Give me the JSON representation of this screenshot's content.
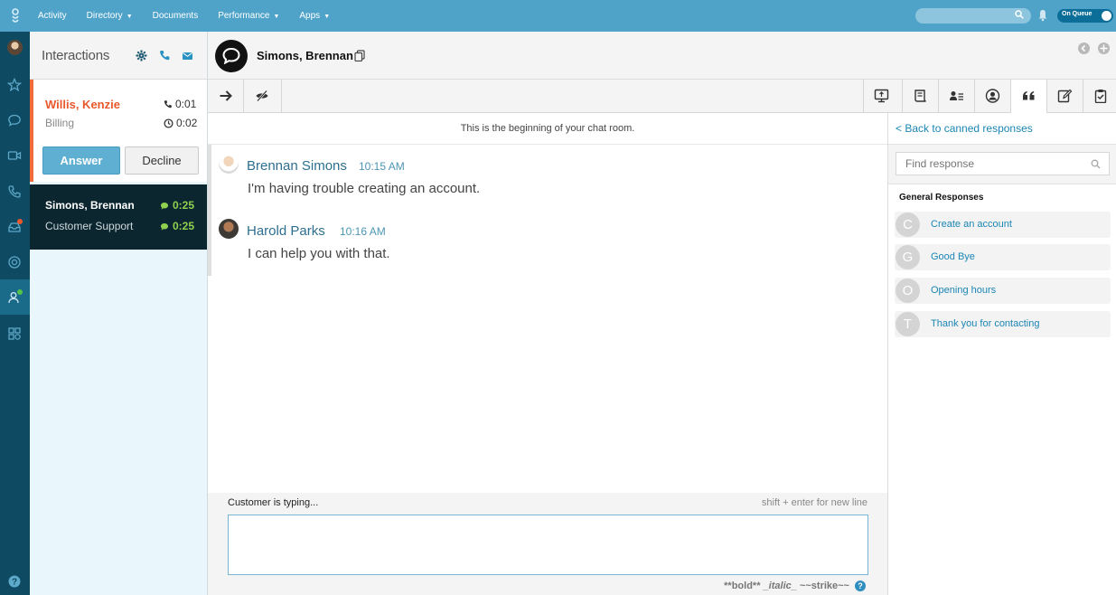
{
  "topnav": {
    "items": [
      {
        "label": "Activity",
        "dropdown": false
      },
      {
        "label": "Directory",
        "dropdown": true
      },
      {
        "label": "Documents",
        "dropdown": false
      },
      {
        "label": "Performance",
        "dropdown": true
      },
      {
        "label": "Apps",
        "dropdown": true
      }
    ],
    "caret": "▼",
    "search_placeholder": "",
    "queue_status": "On Queue"
  },
  "rail": {
    "icons": [
      "avatar",
      "star-icon",
      "chat-icon",
      "video-icon",
      "phone-icon",
      "inbox-icon",
      "lifebuoy-icon",
      "person-icon",
      "apps-icon",
      "help-icon"
    ]
  },
  "interactions": {
    "title": "Interactions",
    "alerting": {
      "name": "Willis, Kenzie",
      "queue": "Billing",
      "call_time": "0:01",
      "wait_time": "0:02",
      "answer_label": "Answer",
      "decline_label": "Decline"
    },
    "active": {
      "name": "Simons, Brennan",
      "queue": "Customer Support",
      "time1": "0:25",
      "time2": "0:25"
    }
  },
  "conversation": {
    "contact_name": "Simons, Brennan",
    "beginning_text": "This is the beginning of your chat room.",
    "messages": [
      {
        "sender": "Brennan Simons",
        "time": "10:15 AM",
        "text": "I'm having trouble creating an account."
      },
      {
        "sender": "Harold Parks",
        "time": "10:16 AM",
        "text": "I can help you with that."
      }
    ],
    "typing_status": "Customer is typing...",
    "newline_hint": "shift + enter for new line",
    "composer_value": "",
    "format_bold": "**bold**",
    "format_italic": "_italic_",
    "format_strike": "~~strike~~",
    "help_glyph": "?"
  },
  "canned": {
    "back_label": "< Back to canned responses",
    "search_placeholder": "Find response",
    "group_title": "General Responses",
    "responses": [
      {
        "letter": "C",
        "label": "Create an account"
      },
      {
        "letter": "G",
        "label": "Good Bye"
      },
      {
        "letter": "O",
        "label": "Opening hours"
      },
      {
        "letter": "T",
        "label": "Thank you for contacting"
      }
    ]
  },
  "colors": {
    "topbar": "#4fa3c9",
    "rail": "#0f4a63",
    "alert_accent": "#f26b3a",
    "answer_button": "#5fafd3",
    "active_card": "#0c2630",
    "timer_green": "#8fd14f",
    "link_blue": "#1b86b4"
  }
}
